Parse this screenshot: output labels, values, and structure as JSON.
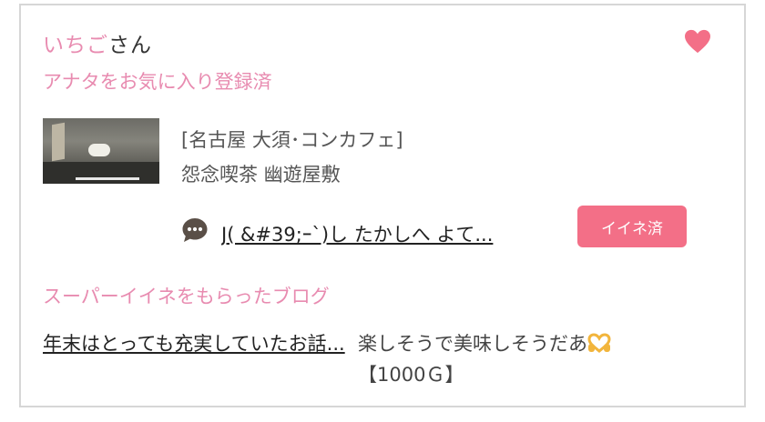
{
  "user": {
    "name": "いちご",
    "suffix": "さん",
    "favorite_status": "アナタをお気に入り登録済"
  },
  "icons": {
    "favorite": "heart-icon",
    "comment": "speech-bubble-icon",
    "emoji": "heart-hands-emoji"
  },
  "colors": {
    "accent_pink": "#e88bb0",
    "button_pink": "#f36f87",
    "heart": "#f36f87"
  },
  "shop": {
    "category": "[名古屋 大須･コンカフェ]",
    "name": "怨念喫茶 幽遊屋敷"
  },
  "comment": {
    "text": "J( &#39;ｰ`)し たかしへ よて..."
  },
  "like_button": {
    "label": "イイネ済"
  },
  "super_like": {
    "section_title": "スーパーイイネをもらったブログ",
    "blog_title": "年末はとっても充実していたお話...",
    "comment": "楽しそうで美味しそうだあ",
    "points": "【1000Ｇ】"
  }
}
